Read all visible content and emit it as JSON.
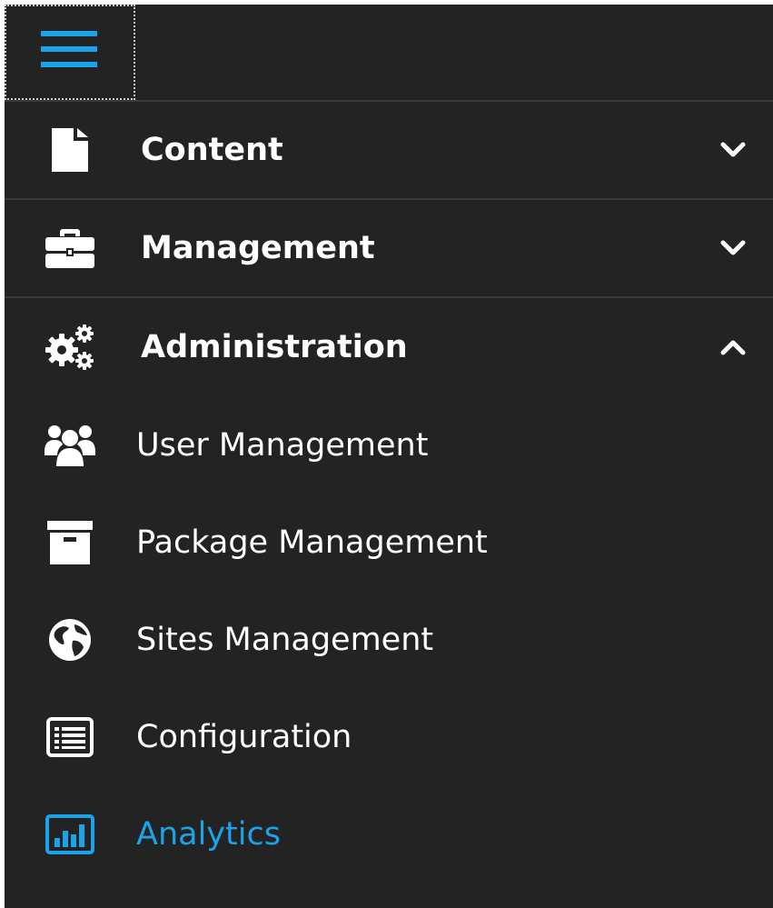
{
  "colors": {
    "background": "#232323",
    "text": "#ffffff",
    "accent": "#1aa3e8",
    "divider": "#3a3a3a"
  },
  "menu_toggle": {
    "icon": "hamburger-icon"
  },
  "sections": [
    {
      "label": "Content",
      "icon": "document-icon",
      "expanded": false,
      "chevron": "chevron-down-icon"
    },
    {
      "label": "Management",
      "icon": "briefcase-icon",
      "expanded": false,
      "chevron": "chevron-down-icon"
    },
    {
      "label": "Administration",
      "icon": "gears-icon",
      "expanded": true,
      "chevron": "chevron-up-icon"
    }
  ],
  "admin_items": [
    {
      "label": "User Management",
      "icon": "users-icon",
      "active": false
    },
    {
      "label": "Package Management",
      "icon": "archive-box-icon",
      "active": false
    },
    {
      "label": "Sites Management",
      "icon": "globe-icon",
      "active": false
    },
    {
      "label": "Configuration",
      "icon": "list-alt-icon",
      "active": false
    },
    {
      "label": "Analytics",
      "icon": "bar-chart-icon",
      "active": true
    }
  ]
}
